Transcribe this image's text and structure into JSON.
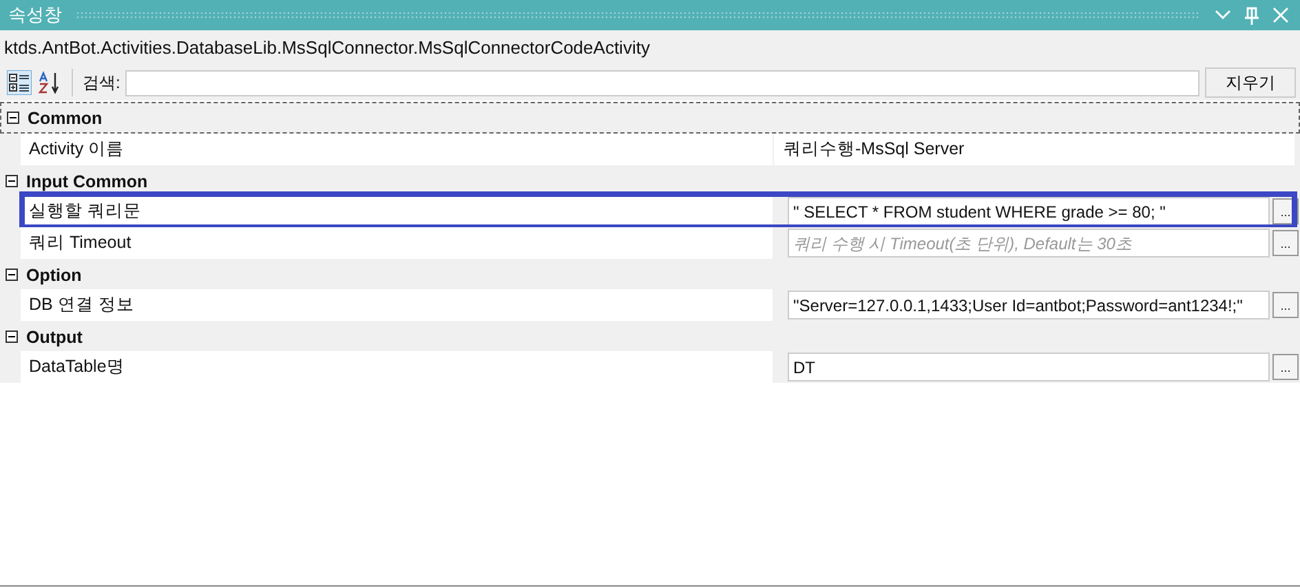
{
  "window": {
    "title": "속성창"
  },
  "type_name": "ktds.AntBot.Activities.DatabaseLib.MsSqlConnector.MsSqlConnectorCodeActivity",
  "toolbar": {
    "categorized_selected": true,
    "alphabetical_selected": false,
    "search_label": "검색:",
    "clear_button": "지우기"
  },
  "ellipsis_button": "...",
  "categories": [
    {
      "name": "Common",
      "expanded": true,
      "properties": [
        {
          "name": "Activity 이름",
          "kind": "text",
          "value": "쿼리수행-MsSql Server",
          "highlighted": false
        }
      ]
    },
    {
      "name": "Input Common",
      "expanded": true,
      "properties": [
        {
          "name": "실행할 쿼리문",
          "kind": "field",
          "value": "\" SELECT * FROM student WHERE grade >= 80; \"",
          "highlighted": true
        },
        {
          "name": "쿼리 Timeout",
          "kind": "field",
          "placeholder": "쿼리 수행 시 Timeout(초 단위), Default는 30초",
          "highlighted": false
        }
      ]
    },
    {
      "name": "Option",
      "expanded": true,
      "properties": [
        {
          "name": "DB 연결 정보",
          "kind": "field",
          "value": "\"Server=127.0.0.1,1433;User Id=antbot;Password=ant1234!;\"",
          "highlighted": false
        }
      ]
    },
    {
      "name": "Output",
      "expanded": true,
      "properties": [
        {
          "name": "DataTable명",
          "kind": "field",
          "value": "DT",
          "highlighted": false
        }
      ]
    }
  ]
}
